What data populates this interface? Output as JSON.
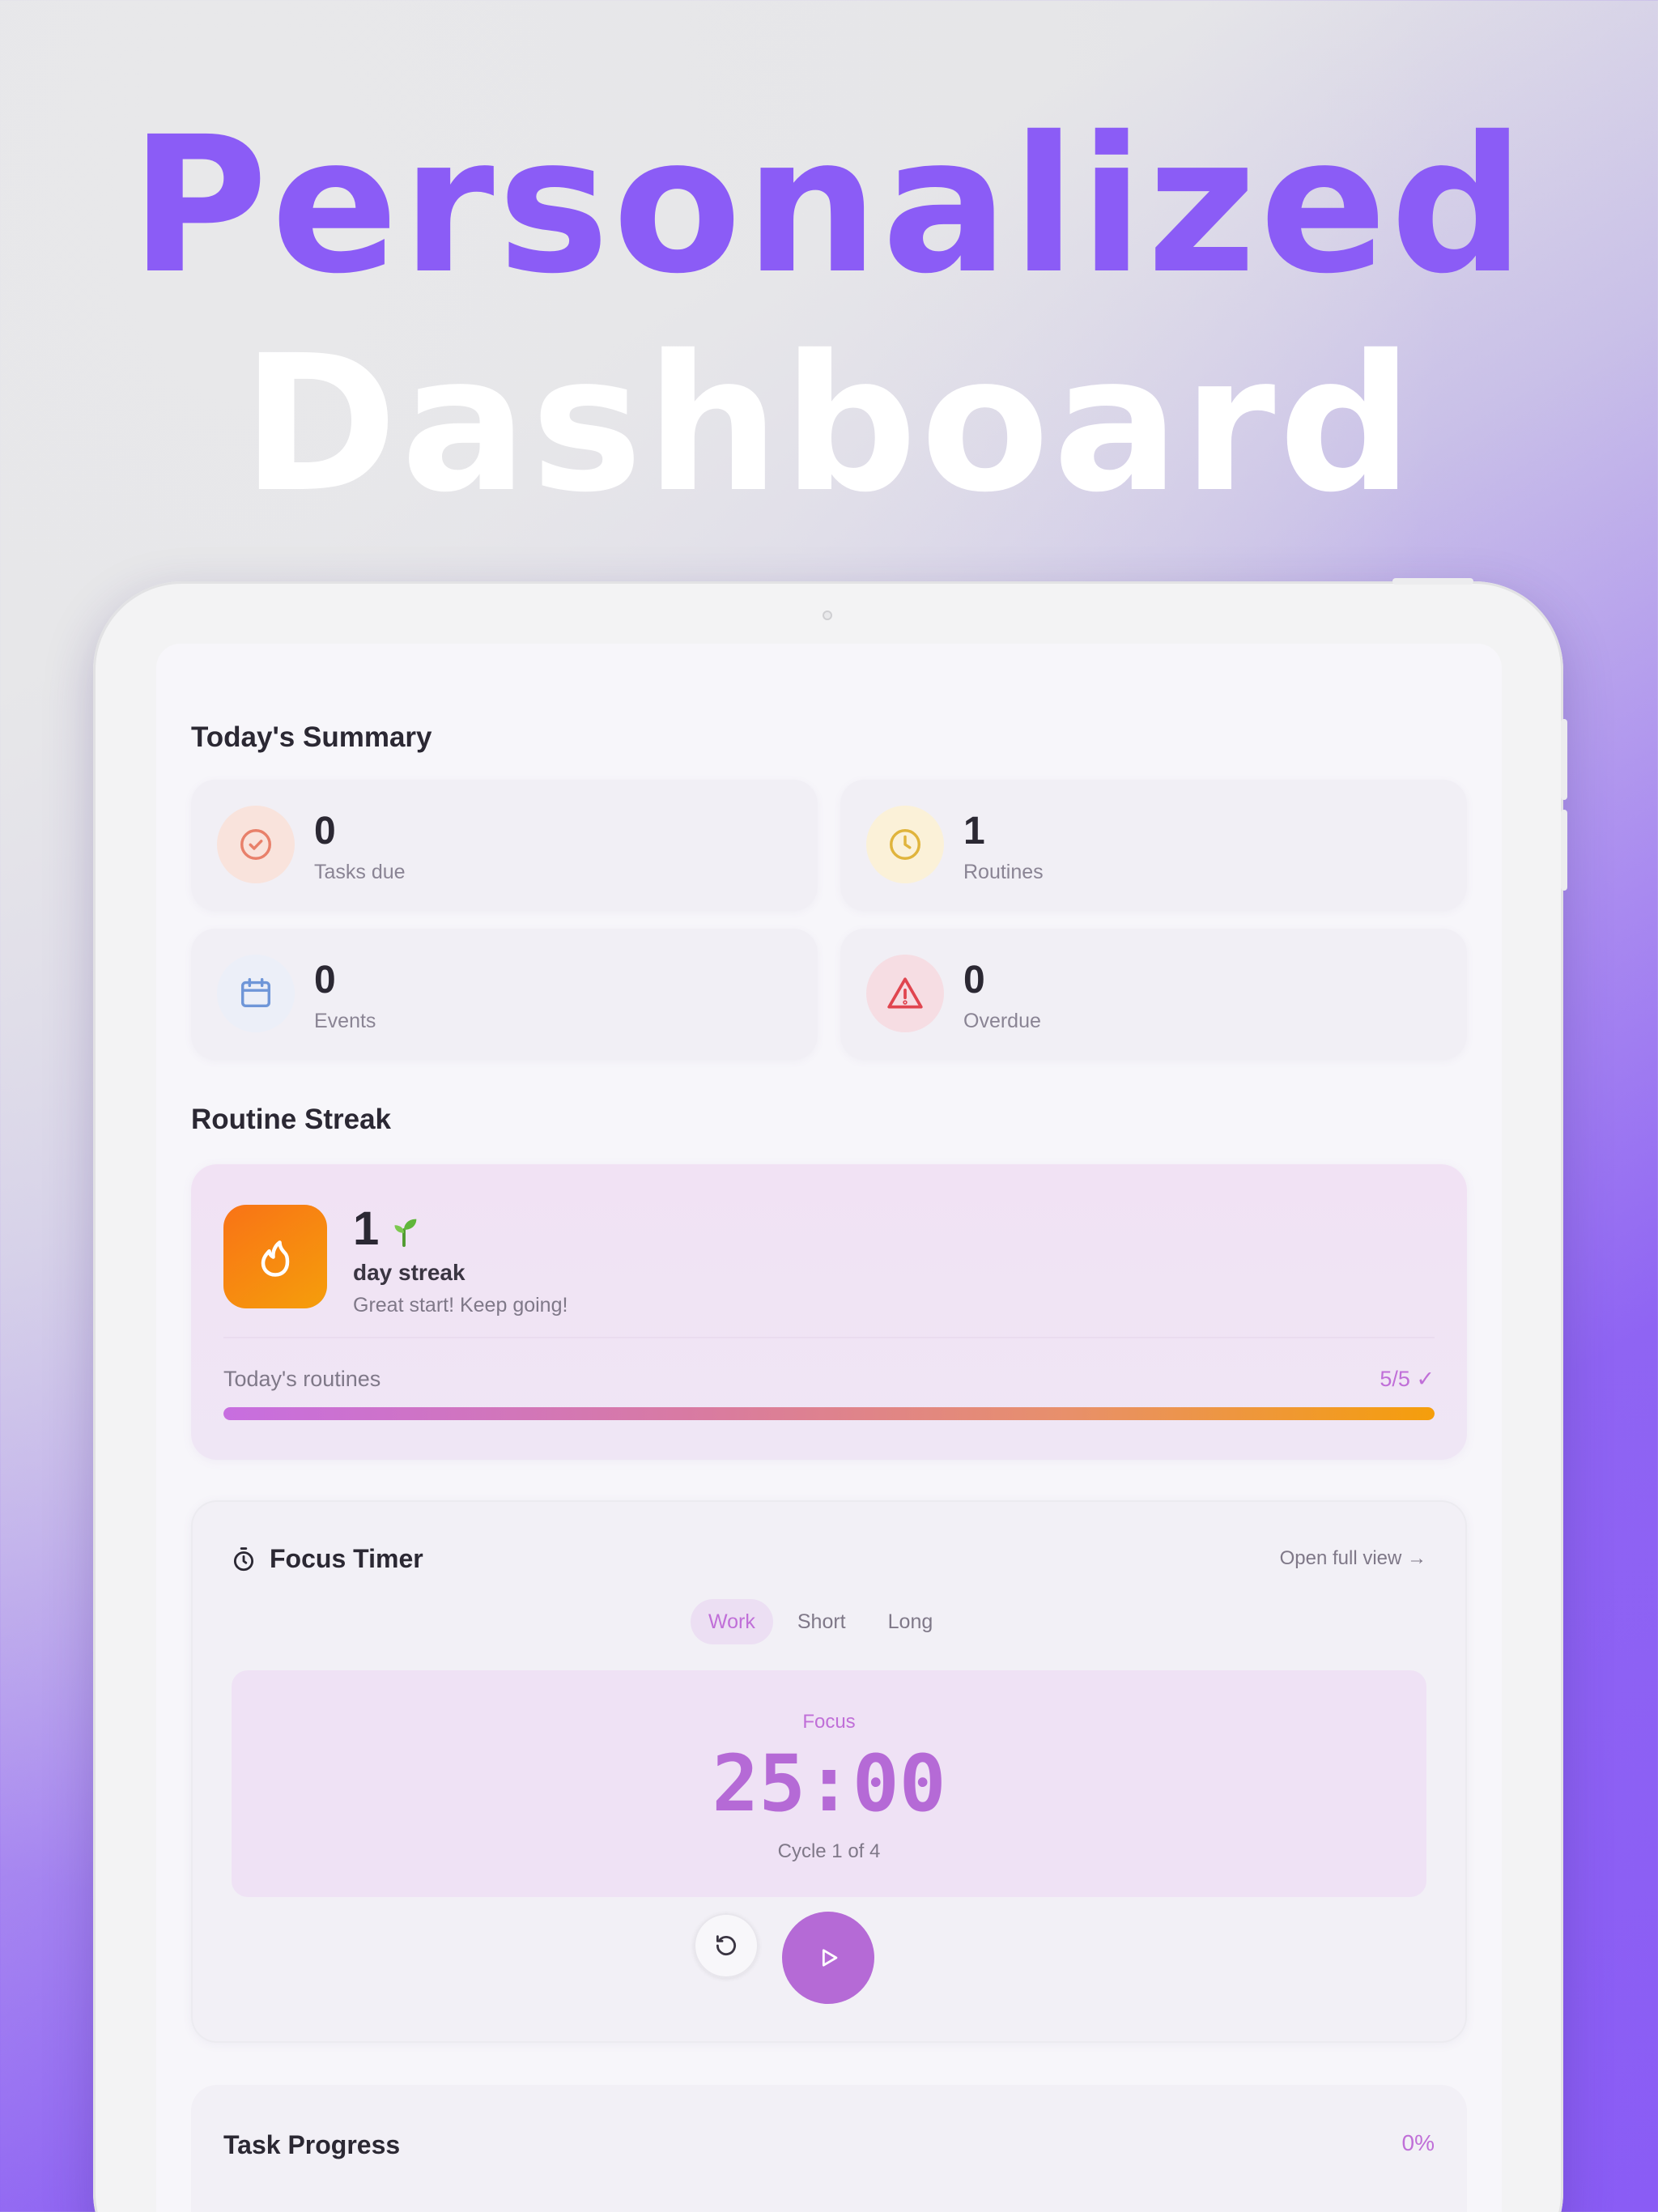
{
  "hero": {
    "line1": "Personalized",
    "line2": "Dashboard"
  },
  "summary": {
    "title": "Today's Summary",
    "cards": [
      {
        "value": "0",
        "label": "Tasks due",
        "icon": "check-circle-icon",
        "color": "#e8806a"
      },
      {
        "value": "1",
        "label": "Routines",
        "icon": "clock-icon",
        "color": "#e0b43c"
      },
      {
        "value": "0",
        "label": "Events",
        "icon": "calendar-icon",
        "color": "#6f96d8"
      },
      {
        "value": "0",
        "label": "Overdue",
        "icon": "warning-icon",
        "color": "#e0454f"
      }
    ]
  },
  "streak": {
    "title": "Routine Streak",
    "count": "1",
    "label": "day streak",
    "message": "Great start! Keep going!",
    "routines_label": "Today's routines",
    "routines_count": "5/5 ✓",
    "progress": 1.0
  },
  "timer": {
    "title": "Focus Timer",
    "open_full": "Open full view →",
    "modes": [
      "Work",
      "Short",
      "Long"
    ],
    "active_mode": "Work",
    "mode_label": "Focus",
    "time": "25:00",
    "cycle": "Cycle 1 of 4"
  },
  "task_progress": {
    "title": "Task Progress",
    "percent": "0%"
  },
  "colors": {
    "accent": "#8b5cf6",
    "timer_accent": "#b56ad6",
    "flame_start": "#f97316",
    "flame_end": "#f59e0b"
  }
}
